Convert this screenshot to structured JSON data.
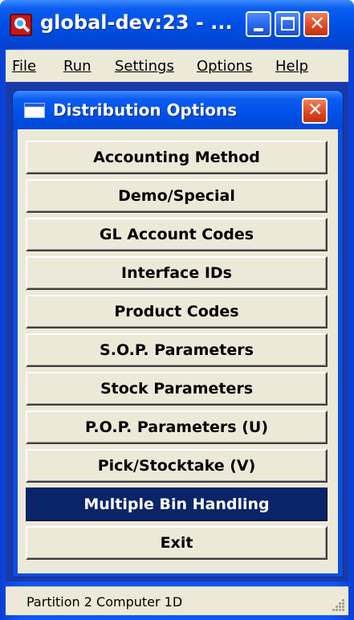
{
  "window": {
    "title": "global-dev:23 - ..."
  },
  "menu": [
    {
      "label": "File"
    },
    {
      "label": "Run"
    },
    {
      "label": "Settings"
    },
    {
      "label": "Options"
    },
    {
      "label": "Help"
    }
  ],
  "dialog": {
    "title": "Distribution Options",
    "buttons": [
      {
        "label": "Accounting Method"
      },
      {
        "label": "Demo/Special"
      },
      {
        "label": "GL Account Codes"
      },
      {
        "label": "Interface IDs"
      },
      {
        "label": "Product Codes"
      },
      {
        "label": "S.O.P. Parameters"
      },
      {
        "label": "Stock Parameters"
      },
      {
        "label": "P.O.P. Parameters (U)"
      },
      {
        "label": "Pick/Stocktake (V)"
      },
      {
        "label": "Multiple Bin Handling",
        "selected": true
      },
      {
        "label": "Exit"
      }
    ]
  },
  "status": {
    "text": "Partition 2 Computer 1D"
  },
  "colors": {
    "titlebar": "#0050e6",
    "selected": "#0a246a",
    "face": "#ece9d8",
    "close": "#e0451e"
  }
}
